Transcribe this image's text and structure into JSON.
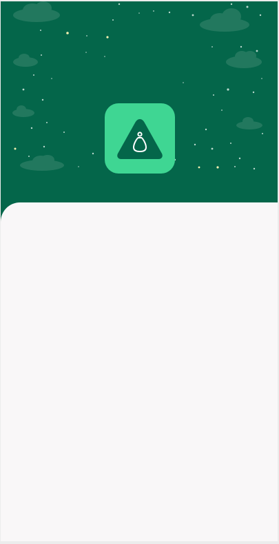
{
  "colors": {
    "header_background": "#04664a",
    "icon_background": "#3fd693",
    "icon_glyph": "#04664a",
    "sheet_background": "#f9f7f8",
    "cloud": "#2a7d63",
    "star": "#b9d8cc"
  },
  "header": {
    "decoration": "starry-sky-with-clouds"
  },
  "app_icon": {
    "icon": "warning-triangle-person-icon"
  },
  "sheet": {}
}
